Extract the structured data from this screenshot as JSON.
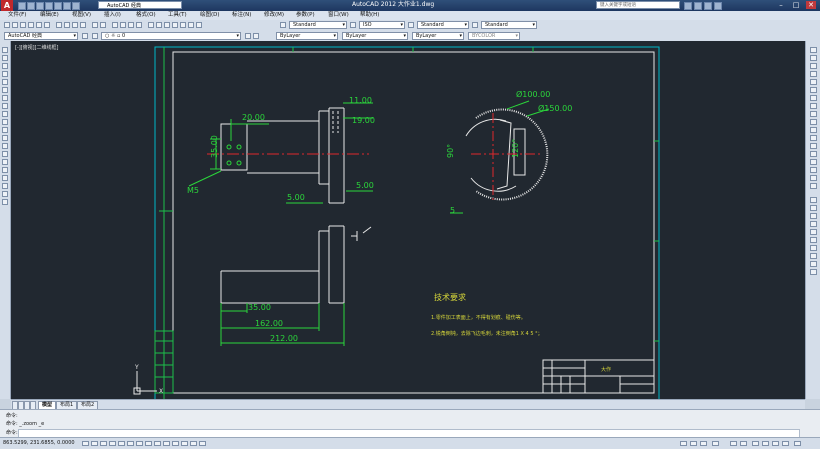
{
  "titlebar": {
    "workspace": "AutoCAD 经典",
    "title": "AutoCAD 2012    大作业1.dwg",
    "search_placeholder": "键入关键字或短语",
    "minimize": "–",
    "maximize": "□",
    "close": "✕"
  },
  "menu": [
    "文件(F)",
    "编辑(E)",
    "视图(V)",
    "插入(I)",
    "格式(O)",
    "工具(T)",
    "绘图(D)",
    "标注(N)",
    "修改(M)",
    "参数(P)",
    "窗口(W)",
    "帮助(H)"
  ],
  "toolbar1": {
    "text_style": "Standard",
    "dim_style": "ISO",
    "table_style": "Standard",
    "multileader_style": "Standard"
  },
  "toolbar2": {
    "workspace": "AutoCAD 经典",
    "layer": "0",
    "color": "ByLayer",
    "linetype": "ByLayer",
    "lineweight": "ByLayer",
    "plotstyle": "BYCOLOR"
  },
  "viewport_label": "[-][俯视][二维线框]",
  "drawing": {
    "dims": {
      "d20": "20.00",
      "d35v": "35.00",
      "m5": "M5",
      "d11": "11.00",
      "d19": "19.00",
      "d5a": "5.00",
      "d5b": "5.00",
      "d100": "Ø100.00",
      "d150": "Ø150.00",
      "a90": "90°",
      "a120": "120°",
      "five": "5",
      "d35": "35.00",
      "d162": "162.00",
      "d212": "212.00"
    },
    "tech_title": "技术要求",
    "tech_1": "1.零件加工表面上，不得有划痕、碰伤等。",
    "tech_2": "2.锐角倒钝，去除飞边毛刺，未注倒角1 X 4 5 °；",
    "title_block_name": "大作",
    "ucs_y": "Y",
    "ucs_x": "X"
  },
  "tabs": [
    "模型",
    "布局1",
    "布局2"
  ],
  "command": {
    "line1": "命令:",
    "line2": "命令: _.zoom _e",
    "prompt": "命令:"
  },
  "status": {
    "coords": "863.5299, 231.6855, 0.0000"
  },
  "colors": {
    "canvas": "#212830",
    "border": "#00d0d0",
    "geometry": "#e8e8e8",
    "dimension": "#2bd63b",
    "center": "#e0282c"
  }
}
